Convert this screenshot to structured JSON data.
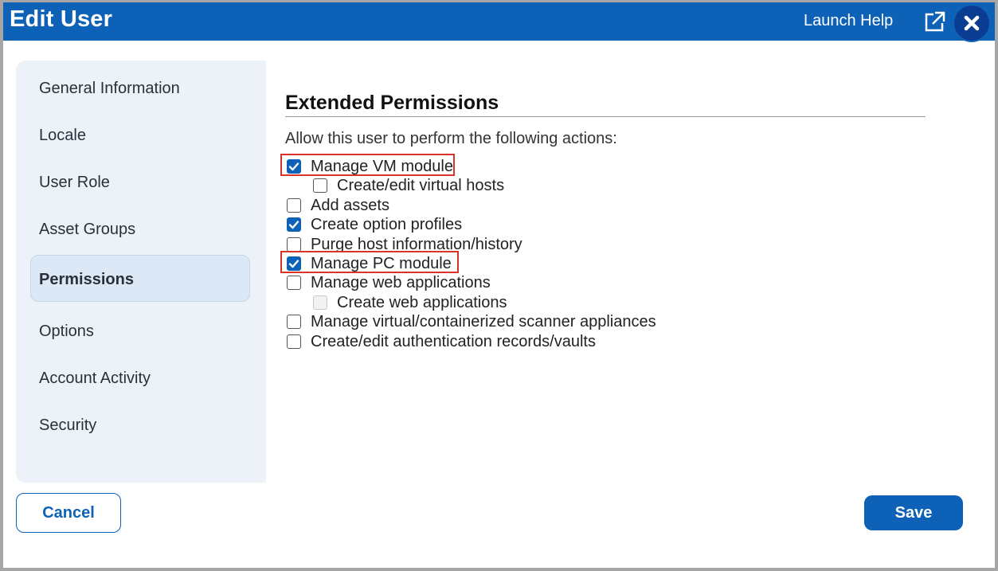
{
  "header": {
    "title": "Edit User",
    "launch_help": "Launch Help",
    "popout_icon": "external-window-icon",
    "close_icon": "close-x-icon"
  },
  "sidebar": {
    "items": [
      {
        "label": "General Information",
        "active": false
      },
      {
        "label": "Locale",
        "active": false
      },
      {
        "label": "User Role",
        "active": false
      },
      {
        "label": "Asset Groups",
        "active": false
      },
      {
        "label": "Permissions",
        "active": true
      },
      {
        "label": "Options",
        "active": false
      },
      {
        "label": "Account Activity",
        "active": false
      },
      {
        "label": "Security",
        "active": false
      }
    ]
  },
  "main": {
    "section_title": "Extended Permissions",
    "intro": "Allow this user to perform the following actions:",
    "permissions": [
      {
        "label": "Manage VM module",
        "checked": true,
        "disabled": false,
        "indented": false,
        "highlighted": true
      },
      {
        "label": "Create/edit virtual hosts",
        "checked": false,
        "disabled": false,
        "indented": true,
        "highlighted": false
      },
      {
        "label": "Add assets",
        "checked": false,
        "disabled": false,
        "indented": false,
        "highlighted": false
      },
      {
        "label": "Create option profiles",
        "checked": true,
        "disabled": false,
        "indented": false,
        "highlighted": false
      },
      {
        "label": "Purge host information/history",
        "checked": false,
        "disabled": false,
        "indented": false,
        "highlighted": false
      },
      {
        "label": "Manage PC module",
        "checked": true,
        "disabled": false,
        "indented": false,
        "highlighted": true
      },
      {
        "label": "Manage web applications",
        "checked": false,
        "disabled": false,
        "indented": false,
        "highlighted": false
      },
      {
        "label": "Create web applications",
        "checked": false,
        "disabled": true,
        "indented": true,
        "highlighted": false
      },
      {
        "label": "Manage virtual/containerized scanner appliances",
        "checked": false,
        "disabled": false,
        "indented": false,
        "highlighted": false
      },
      {
        "label": "Create/edit authentication records/vaults",
        "checked": false,
        "disabled": false,
        "indented": false,
        "highlighted": false
      }
    ]
  },
  "footer": {
    "cancel_label": "Cancel",
    "save_label": "Save"
  },
  "colors": {
    "brand_blue": "#0d62b8",
    "highlight_red": "#d9342b",
    "sidebar_bg": "#edf2f9"
  }
}
